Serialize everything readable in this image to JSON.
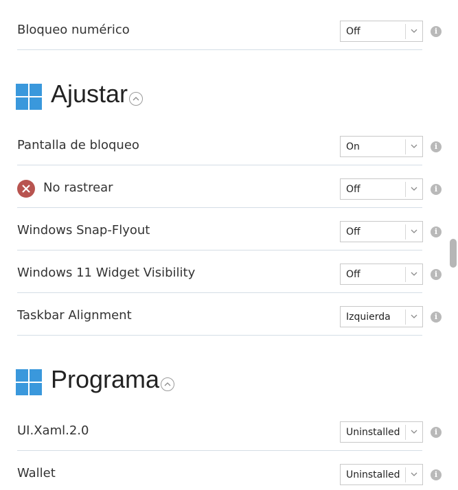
{
  "rows_top": [
    {
      "label": "Bloqueo numérico",
      "value": "Off"
    }
  ],
  "sections": [
    {
      "title": "Ajustar",
      "rows": [
        {
          "label": "Pantalla de bloqueo",
          "value": "On"
        },
        {
          "label": "No rastrear",
          "value": "Off",
          "icon": "error-x-icon"
        },
        {
          "label": "Windows Snap-Flyout",
          "value": "Off"
        },
        {
          "label": "Windows 11 Widget Visibility",
          "value": "Off"
        },
        {
          "label": "Taskbar Alignment",
          "value": "Izquierda"
        }
      ]
    },
    {
      "title": "Programa",
      "rows": [
        {
          "label": "UI.Xaml.2.0",
          "value": "Uninstalled"
        },
        {
          "label": "Wallet",
          "value": "Uninstalled"
        }
      ]
    }
  ],
  "icons": {
    "section": "windows-logo-icon",
    "collapse": "chevron-up-circle-icon",
    "info": "info-icon",
    "dropdown": "chevron-down-icon"
  },
  "colors": {
    "accent": "#3a98dc",
    "error": "#b85450",
    "divider": "#d4dde5"
  }
}
